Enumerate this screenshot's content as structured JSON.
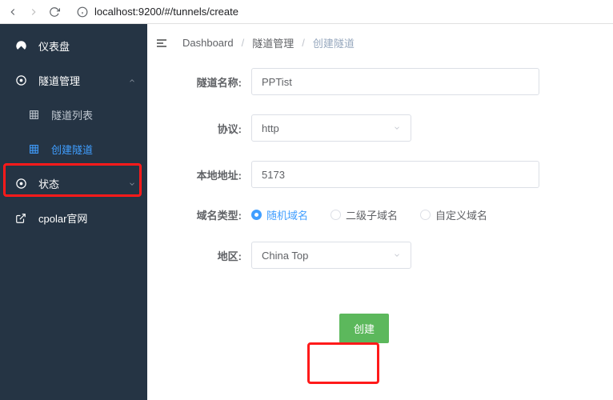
{
  "browser": {
    "url": "localhost:9200/#/tunnels/create"
  },
  "sidebar": {
    "items": [
      {
        "label": "仪表盘"
      },
      {
        "label": "隧道管理"
      },
      {
        "label": "隧道列表"
      },
      {
        "label": "创建隧道"
      },
      {
        "label": "状态"
      },
      {
        "label": "cpolar官网"
      }
    ]
  },
  "breadcrumb": {
    "items": [
      "Dashboard",
      "隧道管理",
      "创建隧道"
    ]
  },
  "form": {
    "tunnel_name": {
      "label": "隧道名称:",
      "value": "PPTist"
    },
    "protocol": {
      "label": "协议:",
      "value": "http"
    },
    "local_addr": {
      "label": "本地地址:",
      "value": "5173"
    },
    "domain_type": {
      "label": "域名类型:",
      "options": [
        "随机域名",
        "二级子域名",
        "自定义域名"
      ],
      "selected": 0
    },
    "region": {
      "label": "地区:",
      "value": "China Top"
    },
    "submit": "创建"
  }
}
